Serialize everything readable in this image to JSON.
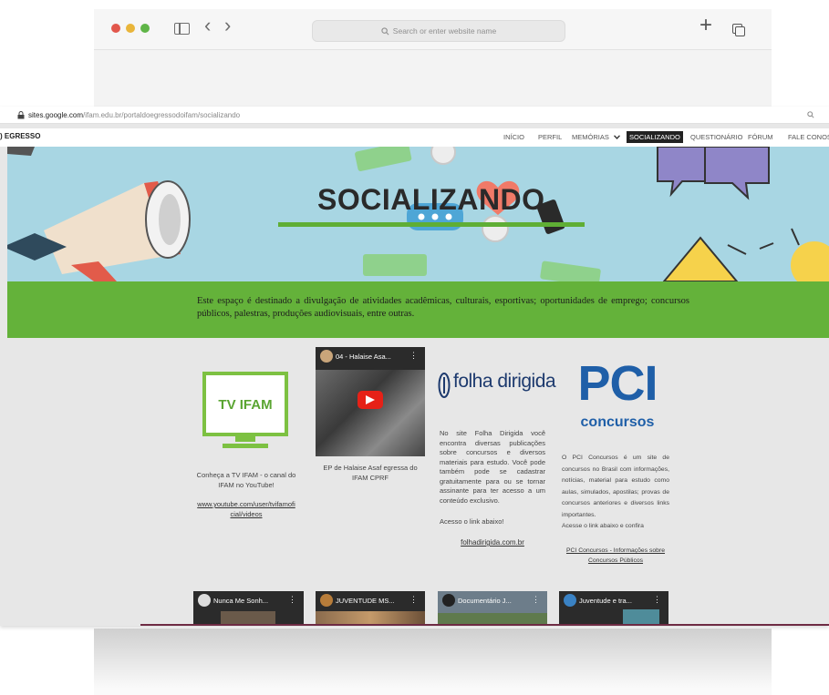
{
  "browser": {
    "address_placeholder": "Search or enter website name",
    "new_tab_symbol": "+",
    "back_symbol": "‹",
    "forward_symbol": "›"
  },
  "site": {
    "url_host": "sites.google.com",
    "url_path": "/ifam.edu.br/portaldoegressodoifam/socializando",
    "brand": ") EGRESSO",
    "nav": [
      "INÍCIO",
      "PERFIL",
      "MEMÓRIAS",
      "SOCIALIZANDO",
      "QUESTIONÁRIO",
      "FÓRUM",
      "FALE CONOSC"
    ],
    "active_nav": "SOCIALIZANDO"
  },
  "hero": {
    "title": "SOCIALIZANDO"
  },
  "intro": {
    "text": "Este espaço é destinado a divulgação de atividades acadêmicas, culturais, esportivas; oportunidades de emprego; concursos públicos, palestras, produções audiovisuais, entre outras."
  },
  "tv_ifam": {
    "logo_text": "TV IFAM",
    "caption": "Conheça a TV IFAM - o canal do IFAM no YouTube!",
    "link": "www.youtube.com/user/tvifamoficial/videos"
  },
  "video1": {
    "title": "04 - Halaise Asa...",
    "caption": "EP de Halaise Asaf egressa do IFAM CPRF"
  },
  "folha": {
    "logo_text": "folha dirigida",
    "body": "No site Folha Dirigida você encontra diversas publicações sobre concursos e diversos materiais para estudo. Você pode também pode se cadastrar gratuitamente para ou se tornar assinante para ter acesso a um conteúdo exclusivo.",
    "cta": "Acesso o link abaixo!",
    "link": "folhadirigida.com.br"
  },
  "pci": {
    "logo_big": "PCI",
    "logo_small": "concursos",
    "body": "O PCI Concursos é um site de concursos no Brasil com informações, notícias, material para estudo como aulas, simulados, apostilas; provas de concursos anteriores e diversos links importantes.",
    "cta": "Acesse o link abaixo e confira",
    "link": "PCI Concursos - Informações sobre Concursos Públicos"
  },
  "bottom_videos": [
    {
      "title": "Nunca Me Sonh..."
    },
    {
      "title": "JUVENTUDE MS..."
    },
    {
      "title": "Documentário J..."
    },
    {
      "title": "Juventude e tra..."
    }
  ],
  "colors": {
    "green": "#64b23a",
    "hero_bg": "#a8d6e3",
    "tv_green": "#7dc142",
    "pci_blue": "#1f5fa8",
    "youtube_red": "#e62117"
  }
}
